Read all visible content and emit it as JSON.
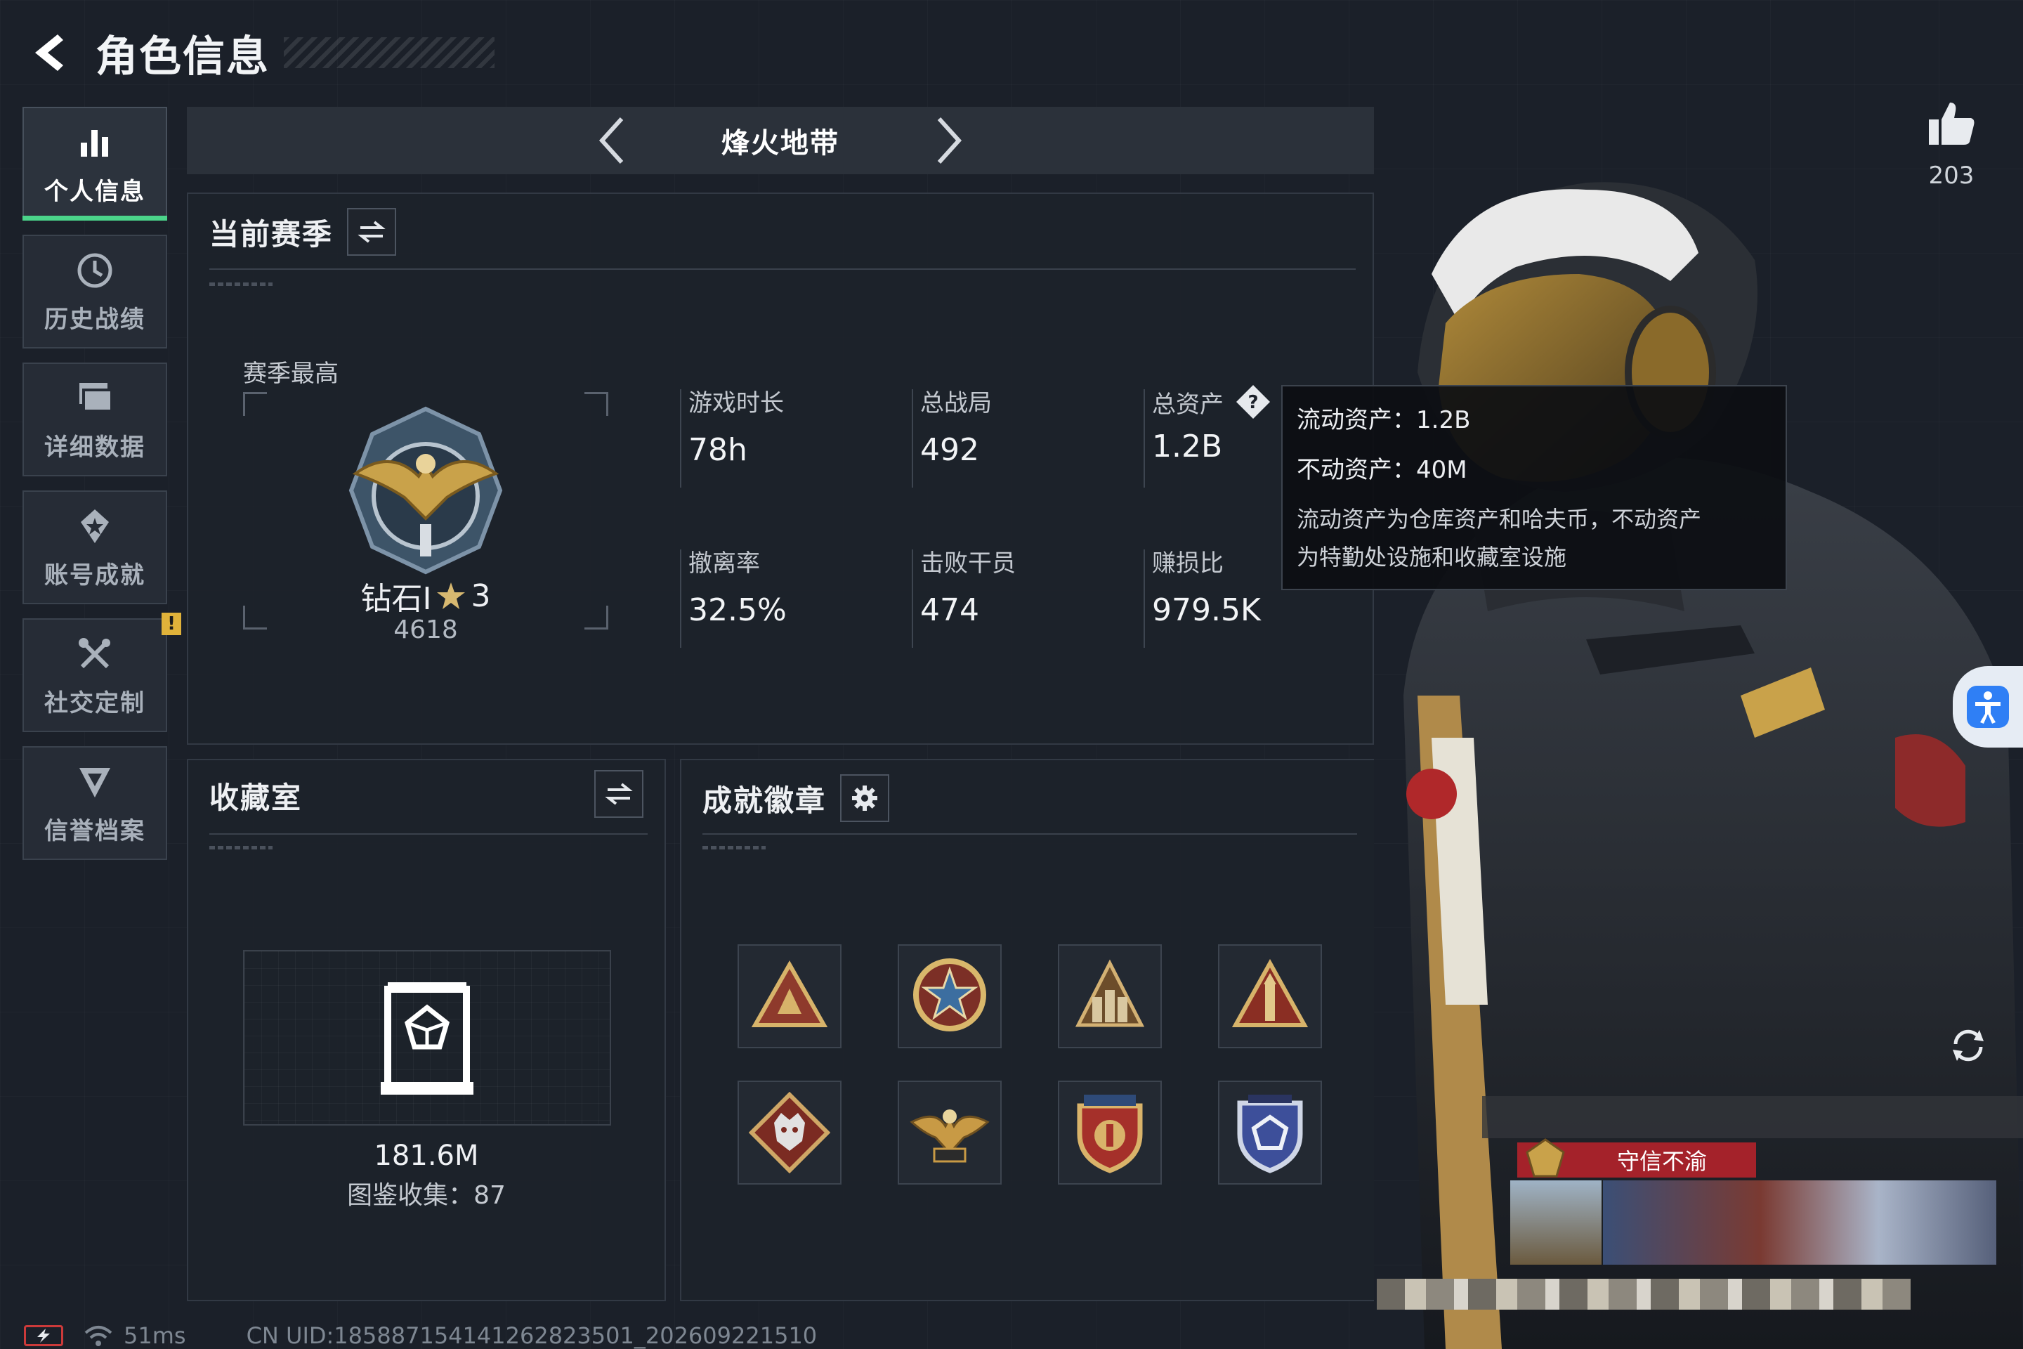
{
  "header": {
    "title": "角色信息"
  },
  "sidebar": {
    "items": [
      {
        "label": "个人信息",
        "icon": "bar-chart-icon",
        "active": true
      },
      {
        "label": "历史战绩",
        "icon": "history-clock-icon"
      },
      {
        "label": "详细数据",
        "icon": "stacked-cards-icon"
      },
      {
        "label": "账号成就",
        "icon": "achievement-star-icon"
      },
      {
        "label": "社交定制",
        "icon": "tools-icon",
        "badge": "!"
      },
      {
        "label": "信誉档案",
        "icon": "credit-shield-icon"
      }
    ]
  },
  "mode_bar": {
    "name": "烽火地带"
  },
  "season": {
    "title": "当前赛季",
    "highest_label": "赛季最高",
    "rank_name": "钻石Ⅰ",
    "rank_stars": "3",
    "rank_score": "4618",
    "stats": [
      {
        "label": "游戏时长",
        "value": "78h"
      },
      {
        "label": "总战局",
        "value": "492"
      },
      {
        "label": "总资产",
        "value": "1.2B"
      },
      {
        "label": "撤离率",
        "value": "32.5%"
      },
      {
        "label": "击败干员",
        "value": "474"
      },
      {
        "label": "赚损比",
        "value": "979.5K"
      }
    ]
  },
  "tooltip": {
    "liquid": "流动资产：1.2B",
    "fixed": "不动资产：40M",
    "desc_line1": "流动资产为仓库资产和哈夫币，不动资产",
    "desc_line2": "为特勤处设施和收藏室设施"
  },
  "collection": {
    "title": "收藏室",
    "value": "181.6M",
    "count_text": "图鉴收集：87"
  },
  "badges": {
    "title": "成就徽章",
    "items": [
      "triangle-emblem",
      "star-wheel-emblem",
      "warriors-emblem",
      "tower-emblem",
      "wolf-emblem",
      "eagle-emblem",
      "shield-stars-emblem",
      "blue-shield-emblem"
    ]
  },
  "character": {
    "likes": "203",
    "honor_tag": "守信不渝"
  },
  "footer": {
    "ping": "51ms",
    "uid": "CN UID:1858871541412628235­01_202609221510"
  },
  "colors": {
    "accent": "#4bd48a",
    "badge": "#e0b23a",
    "tag": "#a4222a",
    "access": "#2f7ff5"
  }
}
